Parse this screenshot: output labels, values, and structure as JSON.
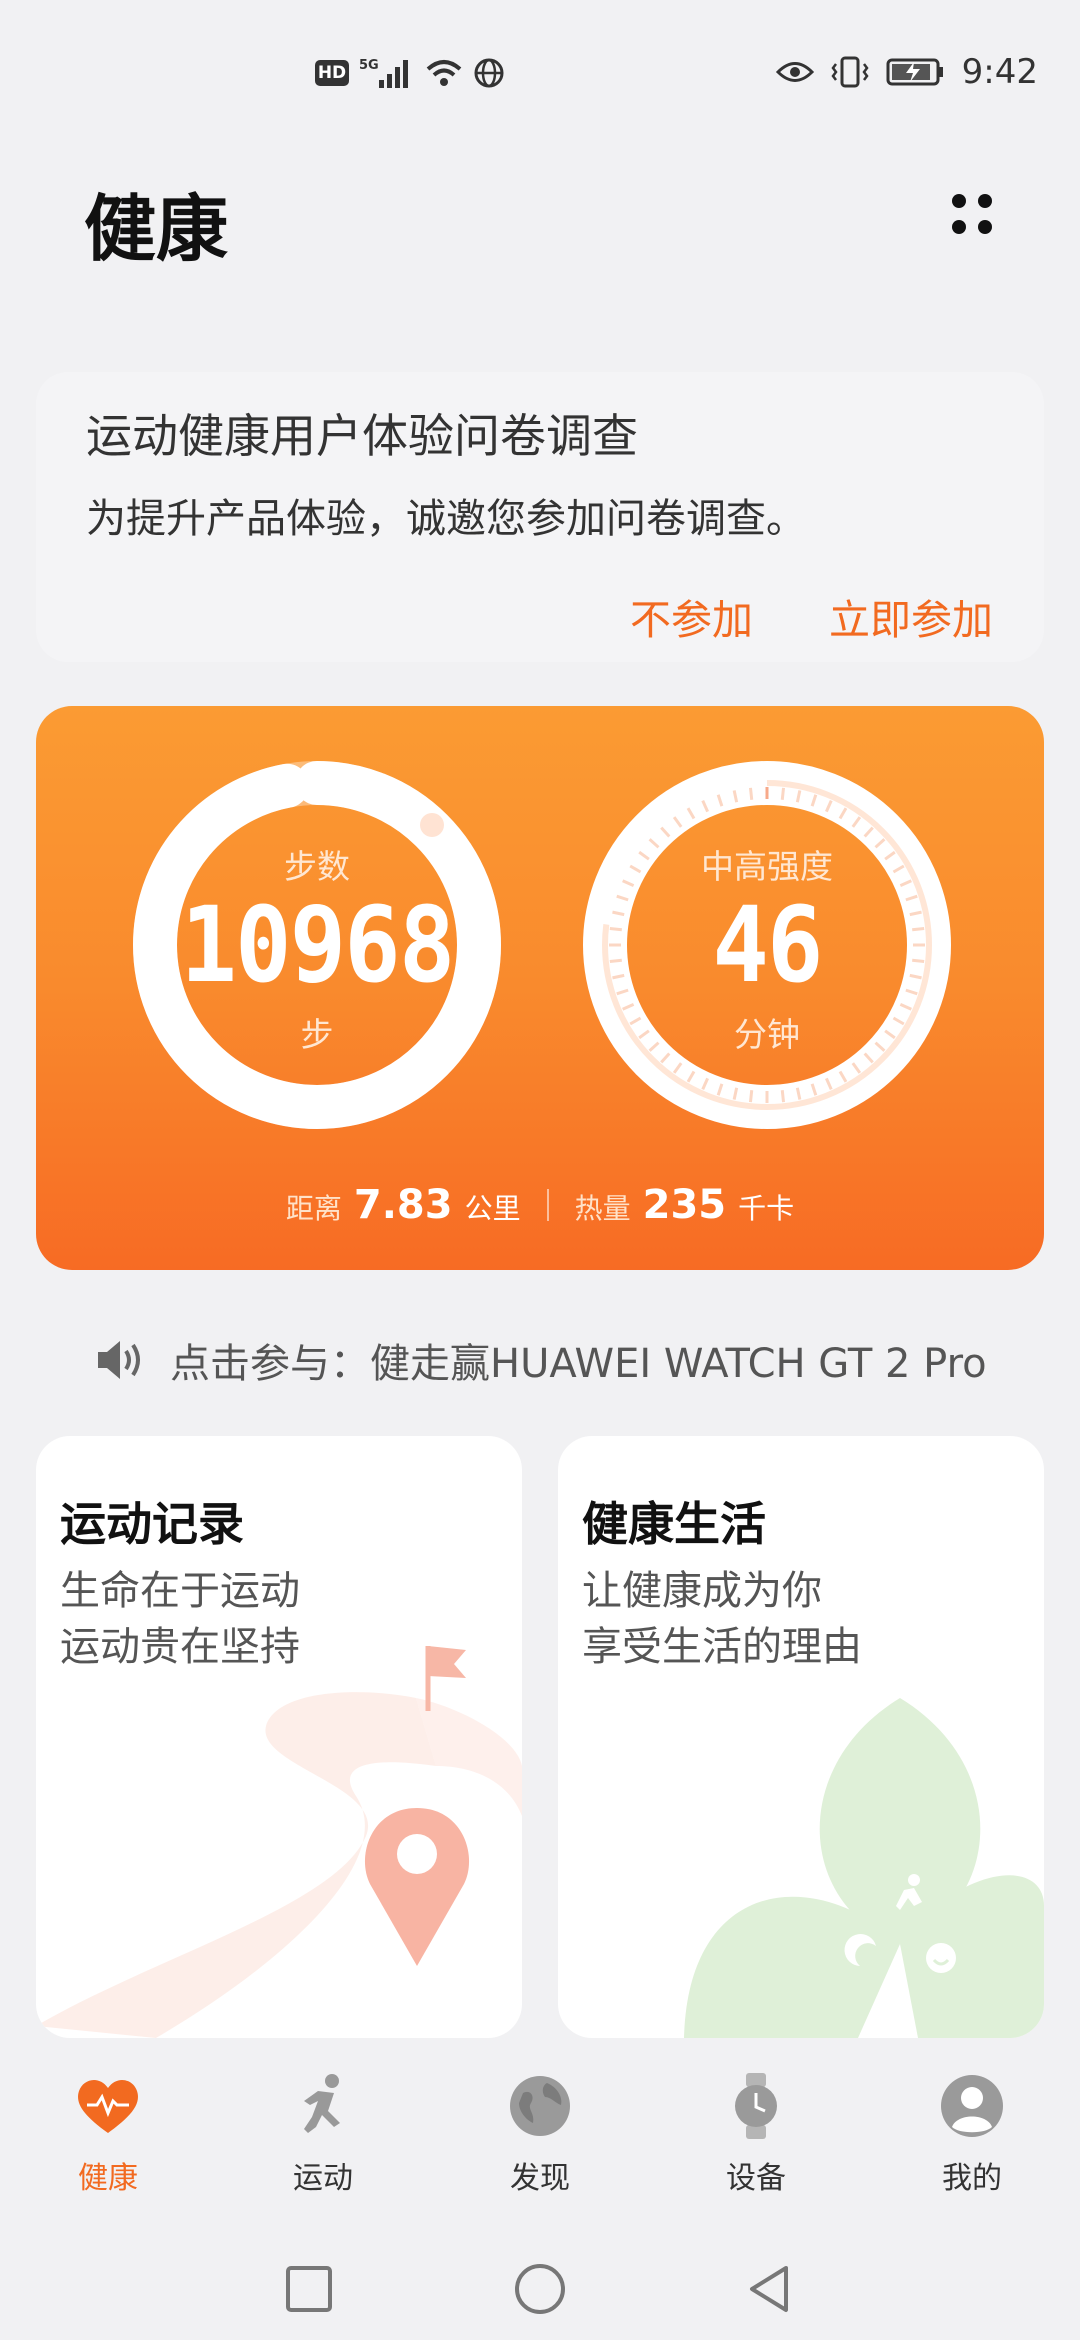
{
  "status_bar": {
    "network_badge": "HD",
    "signal_label": "5G",
    "time": "9:42"
  },
  "header": {
    "title": "健康"
  },
  "survey": {
    "title": "运动健康用户体验问卷调查",
    "description": "为提升产品体验，诚邀您参加问卷调查。",
    "decline_label": "不参加",
    "accept_label": "立即参加"
  },
  "activity": {
    "steps": {
      "label": "步数",
      "value": "10968",
      "unit": "步",
      "progress": 0.97
    },
    "intensity": {
      "label": "中高强度",
      "value": "46",
      "unit": "分钟",
      "progress": 0.77
    },
    "distance": {
      "label": "距离",
      "value": "7.83",
      "unit": "公里"
    },
    "calories": {
      "label": "热量",
      "value": "235",
      "unit": "千卡"
    }
  },
  "promo": {
    "text": "点击参与：健走赢HUAWEI WATCH GT 2 Pro"
  },
  "cards": {
    "exercise": {
      "title": "运动记录",
      "line1": "生命在于运动",
      "line2": "运动贵在坚持"
    },
    "health_life": {
      "title": "健康生活",
      "line1": "让健康成为你",
      "line2": "享受生活的理由"
    }
  },
  "bottom_nav": {
    "items": [
      {
        "label": "健康",
        "icon": "heart-icon",
        "active": true
      },
      {
        "label": "运动",
        "icon": "running-icon",
        "active": false
      },
      {
        "label": "发现",
        "icon": "globe-icon",
        "active": false
      },
      {
        "label": "设备",
        "icon": "watch-icon",
        "active": false
      },
      {
        "label": "我的",
        "icon": "profile-icon",
        "active": false
      }
    ]
  },
  "colors": {
    "accent": "#f26a20",
    "card_gradient_top": "#fb9b33",
    "card_gradient_bottom": "#f76b24",
    "background": "#f1f1f3"
  }
}
